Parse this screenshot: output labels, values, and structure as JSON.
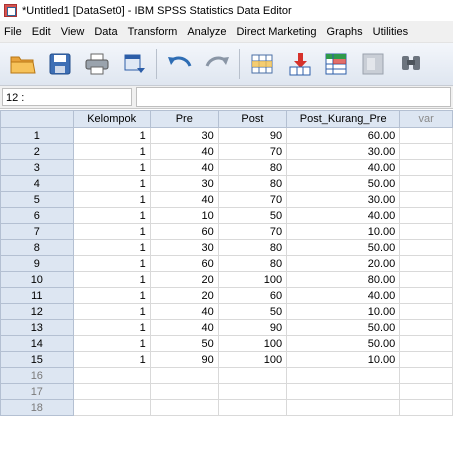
{
  "window": {
    "title": "*Untitled1 [DataSet0] - IBM SPSS Statistics Data Editor"
  },
  "menu": [
    "File",
    "Edit",
    "View",
    "Data",
    "Transform",
    "Analyze",
    "Direct Marketing",
    "Graphs",
    "Utilities"
  ],
  "toolbar": {
    "icons": [
      "open-folder-icon",
      "save-icon",
      "print-icon",
      "dialog-recall-icon",
      "undo-icon",
      "redo-icon",
      "go-to-case-icon",
      "go-to-variable-icon",
      "variables-icon",
      "run-descriptive-icon",
      "find-icon"
    ]
  },
  "cell_editor": {
    "ref": "12 :",
    "value": ""
  },
  "grid": {
    "columns": [
      "Kelompok",
      "Pre",
      "Post",
      "Post_Kurang_Pre",
      "var"
    ],
    "rows": [
      {
        "n": "1",
        "kelompok": "1",
        "pre": "30",
        "post": "90",
        "diff": "60.00"
      },
      {
        "n": "2",
        "kelompok": "1",
        "pre": "40",
        "post": "70",
        "diff": "30.00"
      },
      {
        "n": "3",
        "kelompok": "1",
        "pre": "40",
        "post": "80",
        "diff": "40.00"
      },
      {
        "n": "4",
        "kelompok": "1",
        "pre": "30",
        "post": "80",
        "diff": "50.00"
      },
      {
        "n": "5",
        "kelompok": "1",
        "pre": "40",
        "post": "70",
        "diff": "30.00"
      },
      {
        "n": "6",
        "kelompok": "1",
        "pre": "10",
        "post": "50",
        "diff": "40.00"
      },
      {
        "n": "7",
        "kelompok": "1",
        "pre": "60",
        "post": "70",
        "diff": "10.00"
      },
      {
        "n": "8",
        "kelompok": "1",
        "pre": "30",
        "post": "80",
        "diff": "50.00"
      },
      {
        "n": "9",
        "kelompok": "1",
        "pre": "60",
        "post": "80",
        "diff": "20.00"
      },
      {
        "n": "10",
        "kelompok": "1",
        "pre": "20",
        "post": "100",
        "diff": "80.00"
      },
      {
        "n": "11",
        "kelompok": "1",
        "pre": "20",
        "post": "60",
        "diff": "40.00"
      },
      {
        "n": "12",
        "kelompok": "1",
        "pre": "40",
        "post": "50",
        "diff": "10.00"
      },
      {
        "n": "13",
        "kelompok": "1",
        "pre": "40",
        "post": "90",
        "diff": "50.00"
      },
      {
        "n": "14",
        "kelompok": "1",
        "pre": "50",
        "post": "100",
        "diff": "50.00"
      },
      {
        "n": "15",
        "kelompok": "1",
        "pre": "90",
        "post": "100",
        "diff": "10.00"
      }
    ],
    "empty_rows": [
      "16",
      "17",
      "18"
    ]
  }
}
